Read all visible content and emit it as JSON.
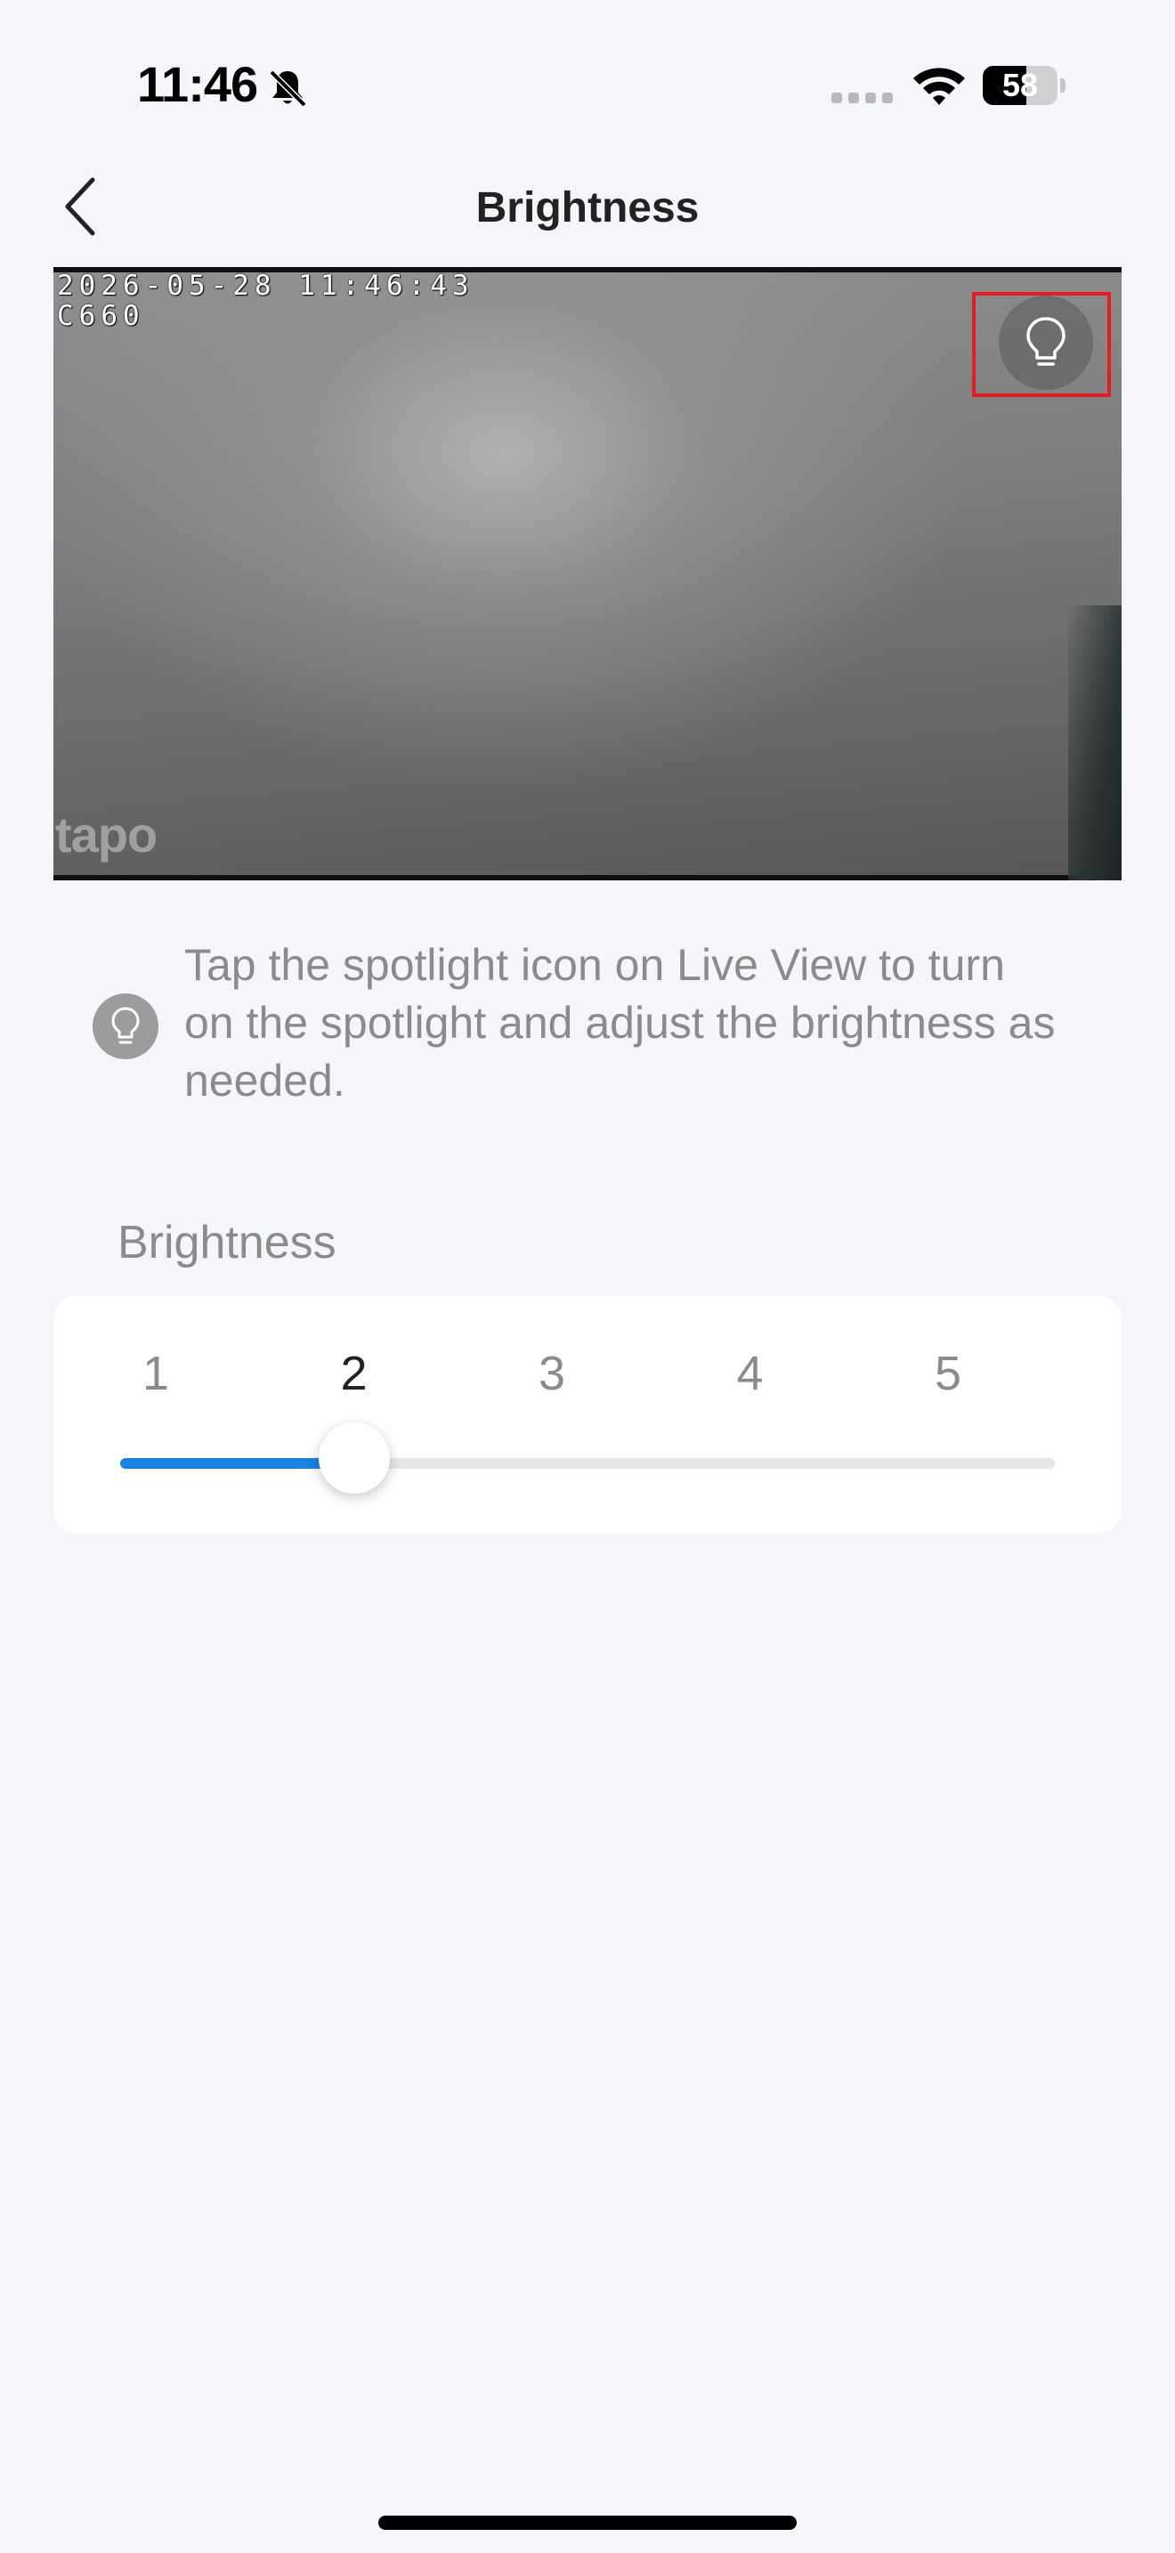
{
  "status_bar": {
    "time": "11:46",
    "battery_level": "58",
    "battery_fraction": 0.58
  },
  "nav": {
    "title": "Brightness",
    "back_icon": "chevron-left-icon"
  },
  "live_view": {
    "osd_timestamp": "2026-05-28 11:46:43",
    "osd_camera": "C660",
    "watermark": "tapo",
    "spotlight_icon": "lightbulb-icon",
    "highlight_color": "#e41b23"
  },
  "tip": {
    "icon": "lightbulb-icon",
    "text": "Tap the spotlight icon on Live View to turn on the spotlight and adjust the brightness as needed."
  },
  "brightness": {
    "label": "Brightness",
    "levels": [
      "1",
      "2",
      "3",
      "4",
      "5"
    ],
    "selected_level": 2,
    "accent": "#1a82e0"
  }
}
